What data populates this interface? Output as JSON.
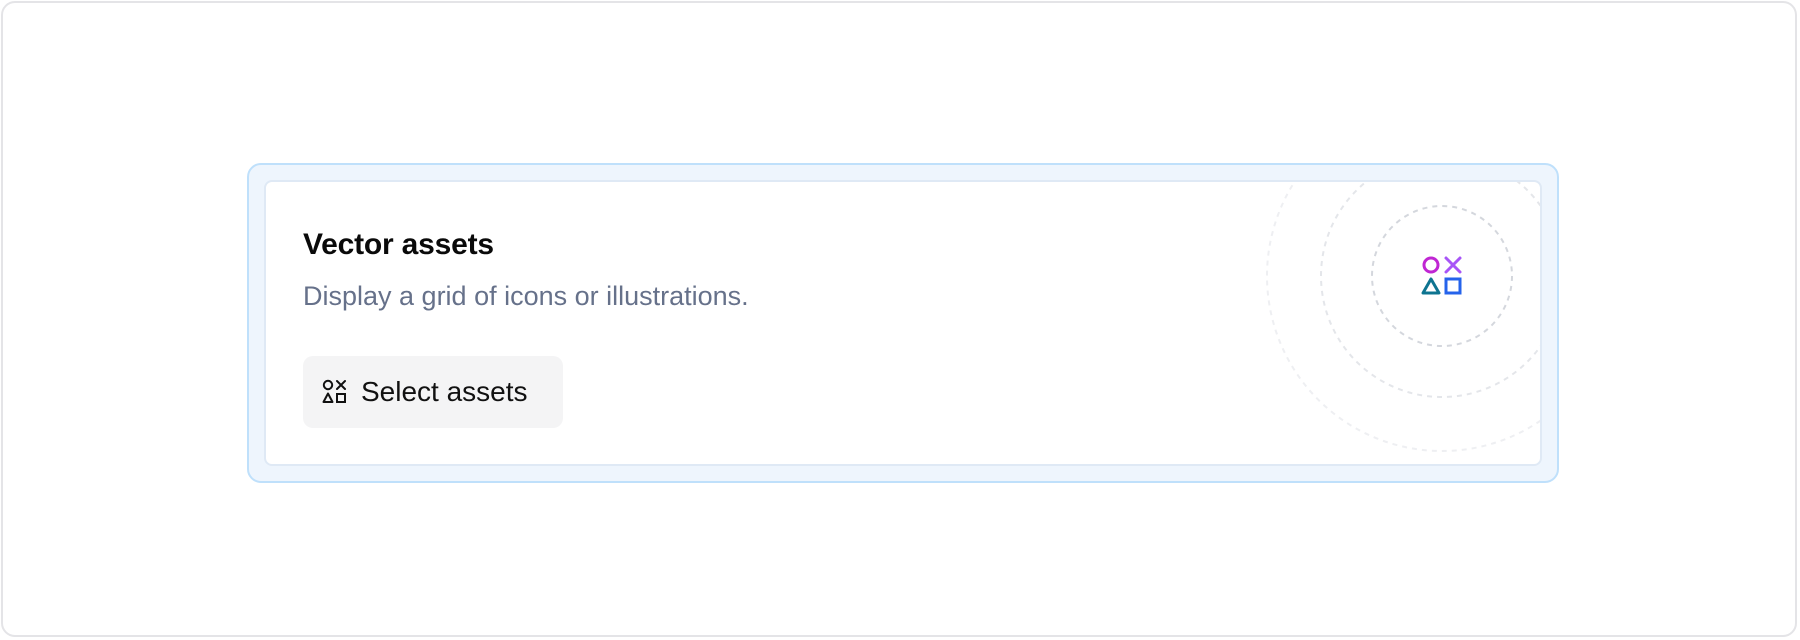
{
  "card": {
    "title": "Vector assets",
    "description": "Display a grid of icons or illustrations.",
    "select_button_label": "Select assets"
  },
  "icons": {
    "button_icon": "shapes-icon",
    "badge_icon": "shapes-icon"
  },
  "colors": {
    "outer_card_background": "#eef5fd",
    "outer_card_border": "#bfe0fb",
    "button_background": "#f4f4f5",
    "description_text": "#66718a",
    "icon_circle": "#c026d3",
    "icon_cross": "#a855f7",
    "icon_triangle": "#0e7490",
    "icon_square": "#2563eb"
  }
}
